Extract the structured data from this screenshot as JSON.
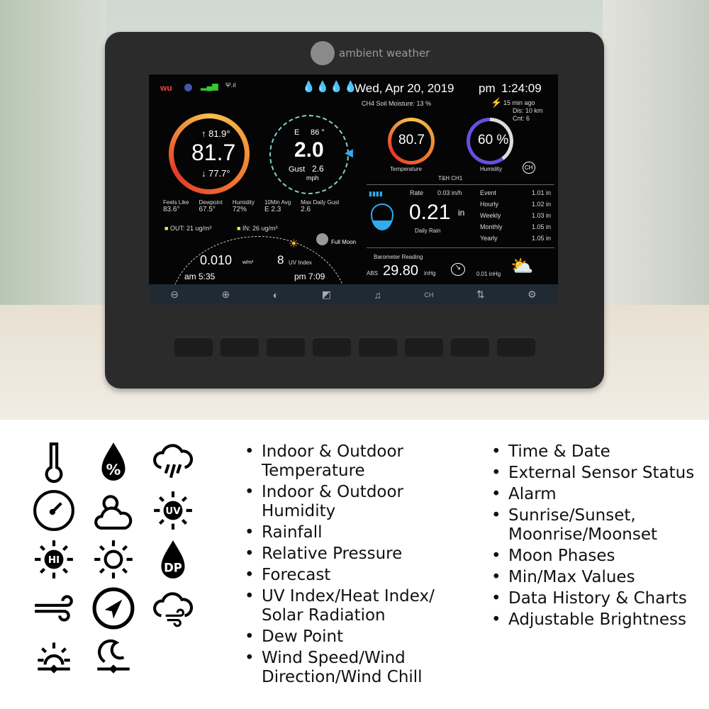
{
  "brand": "ambient weather",
  "screen": {
    "status": {
      "wu": "wu",
      "date": "Wed, Apr  20, 2019",
      "ampm": "pm",
      "time": "1:24:09"
    },
    "soil": "CH4 Soil Moisture: 13 %",
    "lightning": {
      "ago": "15 min ago",
      "dis": "Dis: 10 km",
      "cnt": "Cnt:  6"
    },
    "outdoor": {
      "high": "↑ 81.9°",
      "temp": "81.7",
      "deg": "°",
      "low": "↓ 77.7°"
    },
    "wind": {
      "dir": "E",
      "deg": "86 °",
      "speed": "2.0",
      "gust_label": "Gust",
      "gust": "2.6",
      "unit": "mph"
    },
    "stats": [
      {
        "label": "Feels Like",
        "value": "83.6°"
      },
      {
        "label": "Dewpoint",
        "value": "67.5°"
      },
      {
        "label": "Humidity",
        "value": "72%"
      },
      {
        "label": "10Min Avg",
        "value": "E      2.3"
      },
      {
        "label": "Max Daily Gust",
        "value": "2.6"
      }
    ],
    "pm": {
      "out": "OUT:  21 ug/m³",
      "in": "IN:  26 ug/m³"
    },
    "moon": "Full Moon",
    "solar": {
      "value": "0.010",
      "unit": "w/m²",
      "uv": "8",
      "uv_label": "UV Index",
      "sunrise": "am 5:35",
      "sunset": "pm 7:09"
    },
    "ch1": {
      "temp": "80.7",
      "temp_label": "Temperature",
      "hum": "60 %",
      "hum_label": "Humidity",
      "name": "T&H CH1",
      "ch_icon": "CH",
      "humidity_pct": 60
    },
    "rain": {
      "rate_label": "Rate",
      "rate": "0.03 in/h",
      "daily": "0.21",
      "unit": "in",
      "daily_label": "Daily Rain",
      "rows": [
        {
          "label": "Event",
          "value": "1.01 in"
        },
        {
          "label": "Hourly",
          "value": "1.02 in"
        },
        {
          "label": "Weekly",
          "value": "1.03 in"
        },
        {
          "label": "Monthly",
          "value": "1.05 in"
        },
        {
          "label": "Yearly",
          "value": "1.05 in"
        }
      ]
    },
    "baro": {
      "label": "Barometer Reading",
      "abs": "ABS",
      "value": "29.80",
      "unit": "inHg",
      "change": "0.01 inHg"
    },
    "toolbar": [
      "⊖",
      "⊕",
      "◐",
      "◩",
      "♫",
      "CH",
      "⇅",
      "⚙"
    ]
  },
  "features_left": [
    "Indoor & Outdoor Temperature",
    "Indoor & Outdoor Humidity",
    "Rainfall",
    "Relative Pressure",
    "Forecast",
    "UV Index/Heat Index/ Solar Radiation",
    "Dew Point",
    "Wind Speed/Wind Direction/Wind Chill"
  ],
  "features_right": [
    "Time & Date",
    "External Sensor Status",
    "Alarm",
    "Sunrise/Sunset, Moonrise/Moonset",
    "Moon Phases",
    "Min/Max Values",
    "Data History & Charts",
    "Adjustable Brightness"
  ],
  "icon_labels": {
    "uv": "UV",
    "hi": "HI",
    "dp": "DP",
    "pct": "%"
  }
}
